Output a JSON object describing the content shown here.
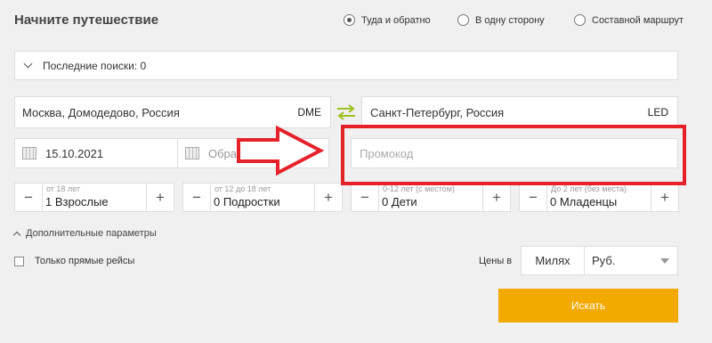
{
  "header": {
    "title": "Начните путешествие"
  },
  "trip_type": {
    "options": [
      {
        "label": "Туда и обратно",
        "checked": true
      },
      {
        "label": "В одну сторону",
        "checked": false
      },
      {
        "label": "Составной маршрут",
        "checked": false
      }
    ]
  },
  "recent_searches": {
    "label": "Последние поиски: 0"
  },
  "route": {
    "from": {
      "city": "Москва, Домодедово, Россия",
      "code": "DME"
    },
    "to": {
      "city": "Санкт-Петербург, Россия",
      "code": "LED"
    },
    "swap_icon": "swap-arrows-icon"
  },
  "dates": {
    "departure": "15.10.2021",
    "return_placeholder": "Обратно"
  },
  "promo": {
    "placeholder": "Промокод"
  },
  "passengers": [
    {
      "sublabel": "от 18 лет",
      "value": "1 Взрослые"
    },
    {
      "sublabel": "от 12 до 18 лет",
      "value": "0 Подростки"
    },
    {
      "sublabel": "0-12 лет (с местом)",
      "value": "0 Дети"
    },
    {
      "sublabel": "До 2 лет (без места)",
      "value": "0 Младенцы"
    }
  ],
  "stepper": {
    "minus": "−",
    "plus": "+"
  },
  "advanced": {
    "label": "Дополнительные параметры"
  },
  "direct_only": {
    "label": "Только прямые рейсы",
    "checked": false
  },
  "prices": {
    "label": "Цены в",
    "miles_label": "Милях",
    "currency": "Руб."
  },
  "search_button": {
    "label": "Искать"
  },
  "colors": {
    "accent": "#f2a900",
    "swap_icon": "#9dc021",
    "annotation": "#e5212a"
  }
}
